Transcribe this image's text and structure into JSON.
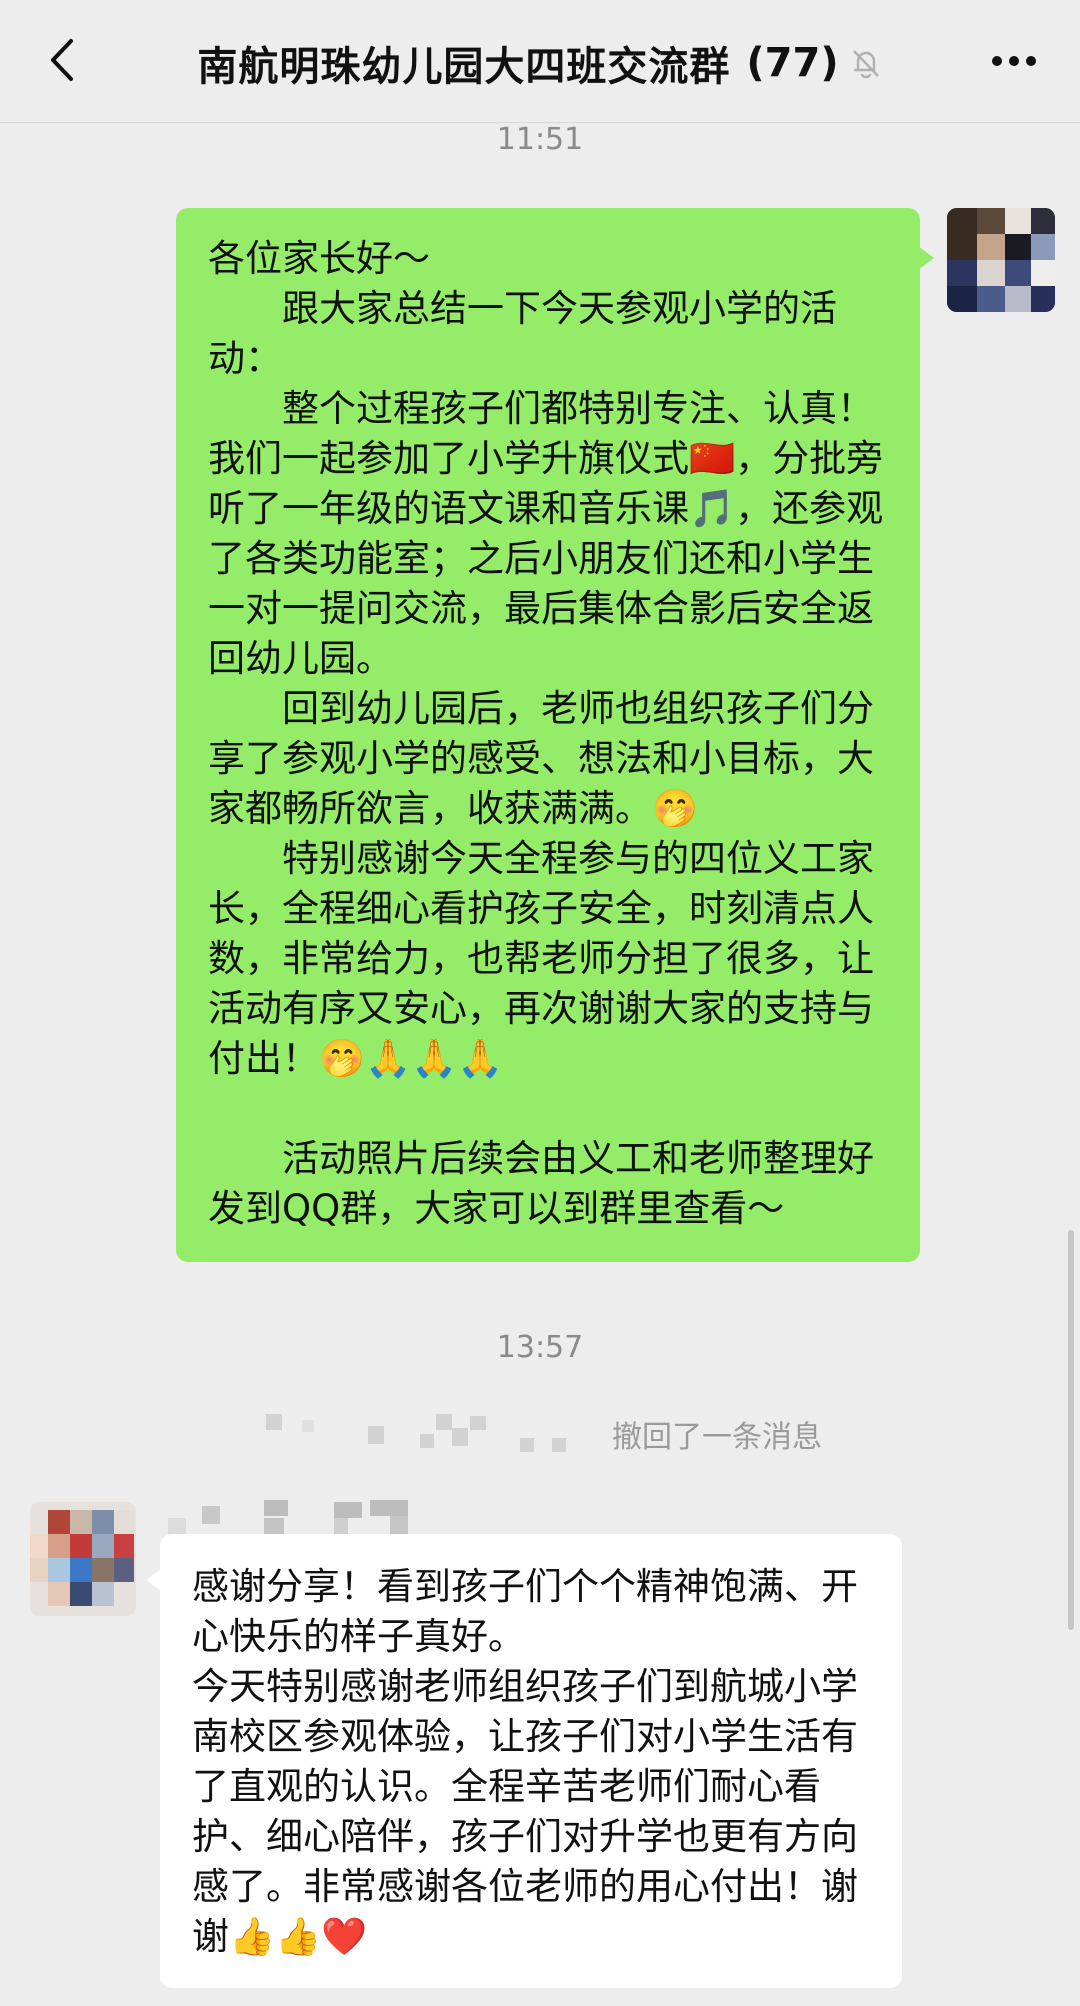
{
  "header": {
    "title": "南航明珠幼儿园大四班交流群",
    "member_count": "(77)",
    "back_icon": "chevron-left-icon",
    "mute_icon": "bell-muted-icon",
    "more_icon": "more-dots-icon"
  },
  "timestamps": [
    "11:51",
    "13:57"
  ],
  "sent_message": {
    "paragraphs": [
      "各位家长好～",
      "　　跟大家总结一下今天参观小学的活动：",
      "　　整个过程孩子们都特别专注、认真！我们一起参加了小学升旗仪式🇨🇳，分批旁听了一年级的语文课和音乐课🎵，还参观了各类功能室；之后小朋友们还和小学生一对一提问交流，最后集体合影后安全返回幼儿园。",
      "　　回到幼儿园后，老师也组织孩子们分享了参观小学的感受、想法和小目标，大家都畅所欲言，收获满满。🤭",
      "　　特别感谢今天全程参与的四位义工家长，全程细心看护孩子安全，时刻清点人数，非常给力，也帮老师分担了很多，让活动有序又安心，再次谢谢大家的支持与付出！🤭🙏🙏🙏",
      "",
      "　　活动照片后续会由义工和老师整理好发到QQ群，大家可以到群里查看～"
    ]
  },
  "recall_notice": "撤回了一条消息",
  "received_message": {
    "paragraphs": [
      "感谢分享！看到孩子们个个精神饱满、开心快乐的样子真好。",
      "今天特别感谢老师组织孩子们到航城小学南校区参观体验，让孩子们对小学生活有了直观的认识。全程辛苦老师们耐心看护、细心陪伴，孩子们对升学也更有方向感了。非常感谢各位老师的用心付出！谢谢👍👍❤️"
    ]
  },
  "colors": {
    "sent_bubble": "#95ec69",
    "received_bubble": "#ffffff",
    "background": "#ededed"
  }
}
